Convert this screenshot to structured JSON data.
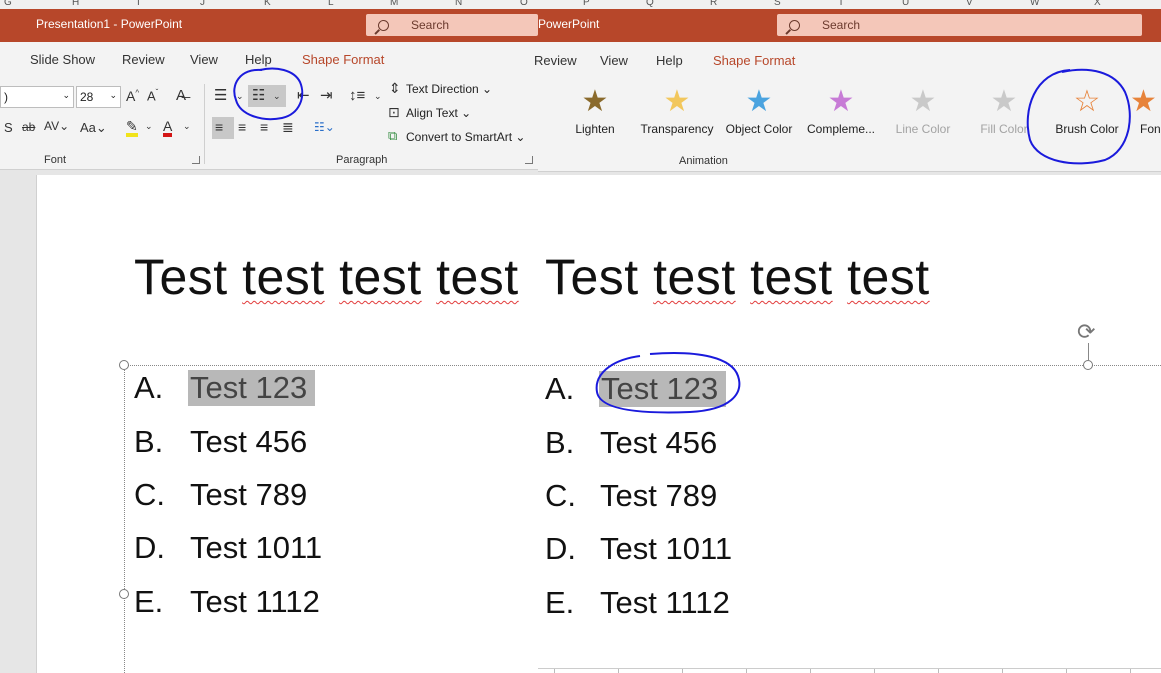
{
  "excel_columns": [
    "G",
    "H",
    "I",
    "J",
    "K",
    "L",
    "M",
    "N",
    "O",
    "P",
    "Q",
    "R",
    "S",
    "T",
    "U",
    "V",
    "W",
    "X"
  ],
  "left_window": {
    "title": "Presentation1  -  PowerPoint",
    "search_placeholder": "Search",
    "tabs": [
      {
        "label": "Slide Show",
        "active": false
      },
      {
        "label": "Review",
        "active": false
      },
      {
        "label": "View",
        "active": false
      },
      {
        "label": "Help",
        "active": false
      },
      {
        "label": "Shape Format",
        "active": true
      }
    ],
    "font_group": {
      "label": "Font",
      "font_name_value": ")",
      "font_size_value": "28"
    },
    "paragraph_group": {
      "label": "Paragraph",
      "text_direction": "Text Direction",
      "align_text": "Align Text",
      "convert_smartart": "Convert to SmartArt"
    }
  },
  "right_window": {
    "title": "PowerPoint",
    "search_placeholder": "Search",
    "tabs": [
      {
        "label": "Review",
        "active": false
      },
      {
        "label": "View",
        "active": false
      },
      {
        "label": "Help",
        "active": false
      },
      {
        "label": "Shape Format",
        "active": true
      }
    ],
    "animation_group": {
      "label": "Animation",
      "effects": [
        {
          "label": "Lighten",
          "color": "#8a6a2c",
          "disabled": false
        },
        {
          "label": "Transparency",
          "color": "#f2c75c",
          "disabled": false
        },
        {
          "label": "Object Color",
          "color": "#4aa3df",
          "disabled": false
        },
        {
          "label": "Compleme...",
          "color": "#c77bd6",
          "disabled": false
        },
        {
          "label": "Line Color",
          "color": "#c9c9c9",
          "disabled": true
        },
        {
          "label": "Fill Color",
          "color": "#c9c9c9",
          "disabled": true
        },
        {
          "label": "Brush Color",
          "color": "#e7833a",
          "disabled": false
        },
        {
          "label": "Fon",
          "color": "#e7833a",
          "disabled": false
        }
      ]
    }
  },
  "slide": {
    "title_left": [
      "Test",
      "test",
      "test",
      "test"
    ],
    "title_right": [
      "Test",
      "test",
      "test",
      "test"
    ],
    "list_left": [
      {
        "marker": "A.",
        "text": "Test 123",
        "highlighted": true
      },
      {
        "marker": "B.",
        "text": "Test 456",
        "highlighted": false
      },
      {
        "marker": "C.",
        "text": "Test 789",
        "highlighted": false
      },
      {
        "marker": "D.",
        "text": "Test 1011",
        "highlighted": false
      },
      {
        "marker": "E.",
        "text": "Test 1112",
        "highlighted": false
      }
    ],
    "list_right": [
      {
        "marker": "A.",
        "text": "Test 123",
        "highlighted": true
      },
      {
        "marker": "B.",
        "text": "Test 456",
        "highlighted": false
      },
      {
        "marker": "C.",
        "text": "Test 789",
        "highlighted": false
      },
      {
        "marker": "D.",
        "text": "Test 1011",
        "highlighted": false
      },
      {
        "marker": "E.",
        "text": "Test 1112",
        "highlighted": false
      }
    ]
  },
  "annotation_color": "#1a1adc",
  "accent_color": "#b7472a"
}
